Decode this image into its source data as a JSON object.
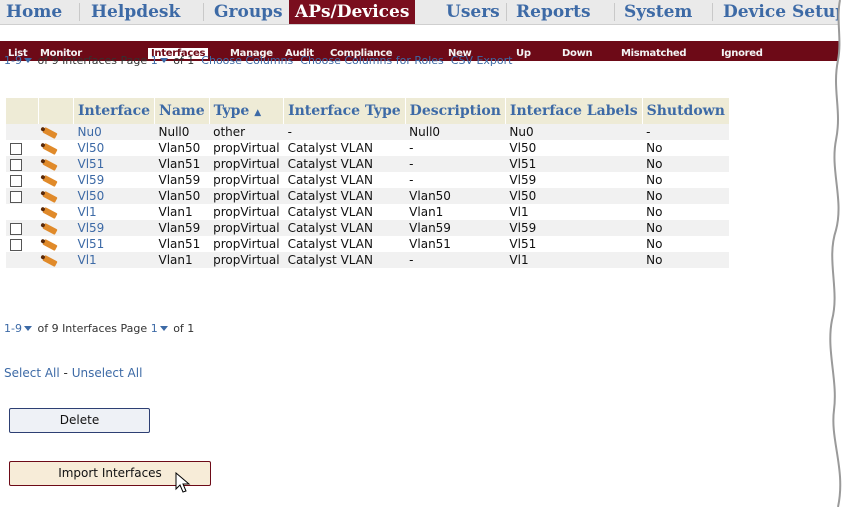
{
  "topnav": {
    "tabs": [
      {
        "label": "Home",
        "active": false
      },
      {
        "label": "Helpdesk",
        "active": false
      },
      {
        "label": "Groups",
        "active": false
      },
      {
        "label": "APs/Devices",
        "active": true
      },
      {
        "label": "Users",
        "active": false
      },
      {
        "label": "Reports",
        "active": false
      },
      {
        "label": "System",
        "active": false
      },
      {
        "label": "Device Setup",
        "active": false
      }
    ]
  },
  "subnav": {
    "items": [
      {
        "label": "List"
      },
      {
        "label": "Monitor"
      },
      {
        "label": "Interfaces",
        "active": true
      },
      {
        "label": "Manage"
      },
      {
        "label": "Audit"
      },
      {
        "label": "Compliance"
      },
      {
        "label": "New"
      },
      {
        "label": "Up"
      },
      {
        "label": "Down"
      },
      {
        "label": "Mismatched"
      },
      {
        "label": "Ignored"
      }
    ]
  },
  "pager_top": {
    "range": "1-9",
    "of_text": "of 9 Interfaces",
    "page_label": "Page",
    "page": "1",
    "page_of": "of 1",
    "choose_columns": "Choose Columns",
    "choose_columns_roles": "Choose Columns for Roles",
    "csv_export": "CSV Export"
  },
  "table": {
    "headers": [
      "Interface",
      "Name",
      "Type",
      "Interface Type",
      "Description",
      "Interface Labels",
      "Shutdown"
    ],
    "sort_indicator": "▲",
    "rows": [
      {
        "checkbox": false,
        "interface": "Nu0",
        "name": "Null0",
        "type": "other",
        "interface_type": "-",
        "description": "Null0",
        "labels": "Nu0",
        "shutdown": "-"
      },
      {
        "checkbox": true,
        "interface": "Vl50",
        "name": "Vlan50",
        "type": "propVirtual",
        "interface_type": "Catalyst VLAN",
        "description": "-",
        "labels": "Vl50",
        "shutdown": "No"
      },
      {
        "checkbox": true,
        "interface": "Vl51",
        "name": "Vlan51",
        "type": "propVirtual",
        "interface_type": "Catalyst VLAN",
        "description": "-",
        "labels": "Vl51",
        "shutdown": "No"
      },
      {
        "checkbox": true,
        "interface": "Vl59",
        "name": "Vlan59",
        "type": "propVirtual",
        "interface_type": "Catalyst VLAN",
        "description": "-",
        "labels": "Vl59",
        "shutdown": "No"
      },
      {
        "checkbox": true,
        "interface": "Vl50",
        "name": "Vlan50",
        "type": "propVirtual",
        "interface_type": "Catalyst VLAN",
        "description": "Vlan50",
        "labels": "Vl50",
        "shutdown": "No"
      },
      {
        "checkbox": false,
        "interface": "Vl1",
        "name": "Vlan1",
        "type": "propVirtual",
        "interface_type": "Catalyst VLAN",
        "description": "Vlan1",
        "labels": "Vl1",
        "shutdown": "No"
      },
      {
        "checkbox": true,
        "interface": "Vl59",
        "name": "Vlan59",
        "type": "propVirtual",
        "interface_type": "Catalyst VLAN",
        "description": "Vlan59",
        "labels": "Vl59",
        "shutdown": "No"
      },
      {
        "checkbox": true,
        "interface": "Vl51",
        "name": "Vlan51",
        "type": "propVirtual",
        "interface_type": "Catalyst VLAN",
        "description": "Vlan51",
        "labels": "Vl51",
        "shutdown": "No"
      },
      {
        "checkbox": false,
        "interface": "Vl1",
        "name": "Vlan1",
        "type": "propVirtual",
        "interface_type": "Catalyst VLAN",
        "description": "-",
        "labels": "Vl1",
        "shutdown": "No"
      }
    ]
  },
  "pager_bottom": {
    "range": "1-9",
    "of_text": "of 9 Interfaces",
    "page_label": "Page",
    "page": "1",
    "page_of": "of 1"
  },
  "selection": {
    "select_all": "Select All",
    "separator": " - ",
    "unselect_all": "Unselect All"
  },
  "actions": {
    "delete_label": "Delete",
    "import_label": "Import Interfaces"
  },
  "colors": {
    "link": "#3d6aa6",
    "brand": "#6d0a17",
    "header_bg": "#eeebd6"
  }
}
